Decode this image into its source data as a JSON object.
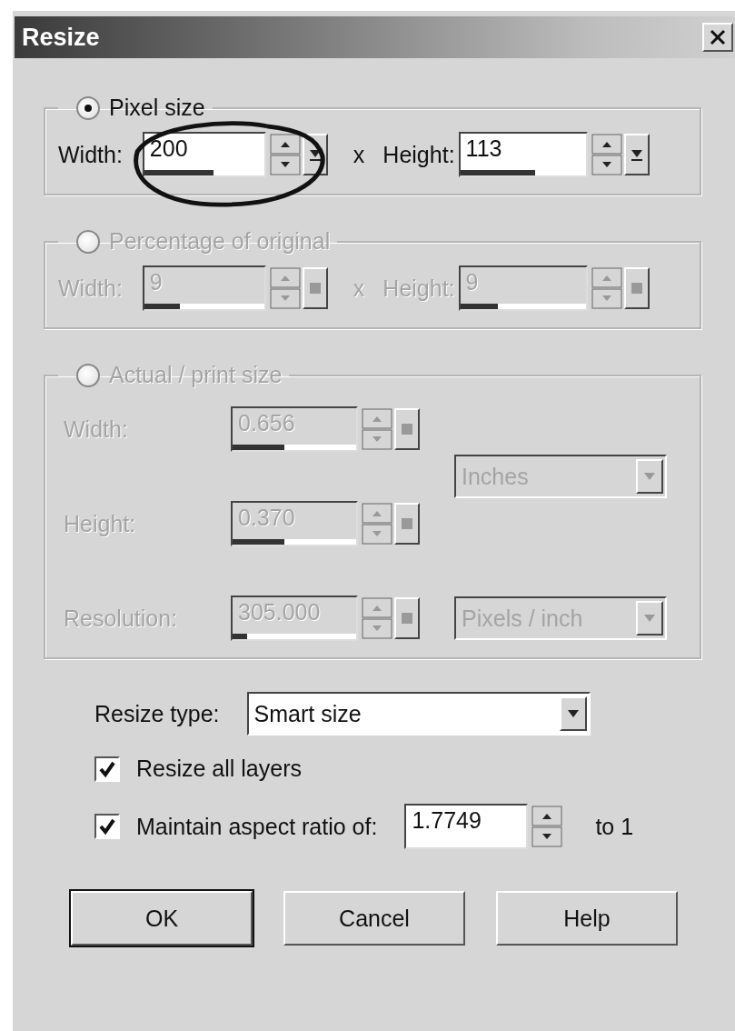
{
  "window": {
    "title": "Resize"
  },
  "groups": [
    {
      "kind": "pair",
      "label": "Pixel size",
      "selected": true,
      "disabled": false,
      "separator": "x",
      "fields": [
        {
          "label": "Width:",
          "value": "200",
          "level": 0.58
        },
        {
          "label": "Height:",
          "value": "113",
          "level": 0.6
        }
      ]
    },
    {
      "kind": "pair",
      "label": "Percentage of original",
      "selected": false,
      "disabled": true,
      "separator": "x",
      "fields": [
        {
          "label": "Width:",
          "value": "9",
          "level": 0.3
        },
        {
          "label": "Height:",
          "value": "9",
          "level": 0.3
        }
      ]
    },
    {
      "kind": "grid",
      "label": "Actual / print size",
      "selected": false,
      "disabled": true,
      "fields": [
        {
          "label": "Width:",
          "value": "0.656",
          "level": 0.42
        },
        {
          "label": "Height:",
          "value": "0.370",
          "level": 0.42
        },
        {
          "label": "Resolution:",
          "value": "305.000",
          "level": 0.12
        }
      ],
      "dropdowns": [
        {
          "value": "Inches"
        },
        {
          "value": "Pixels / inch"
        }
      ]
    }
  ],
  "resize_type": {
    "label": "Resize type:",
    "value": "Smart size"
  },
  "options": [
    {
      "label": "Resize all layers",
      "checked": true
    },
    {
      "label": "Maintain aspect ratio of:",
      "checked": true
    }
  ],
  "aspect": {
    "value": "1.7749",
    "suffix": "to 1"
  },
  "buttons": [
    {
      "label": "OK",
      "default": true
    },
    {
      "label": "Cancel",
      "default": false
    },
    {
      "label": "Help",
      "default": false
    }
  ]
}
